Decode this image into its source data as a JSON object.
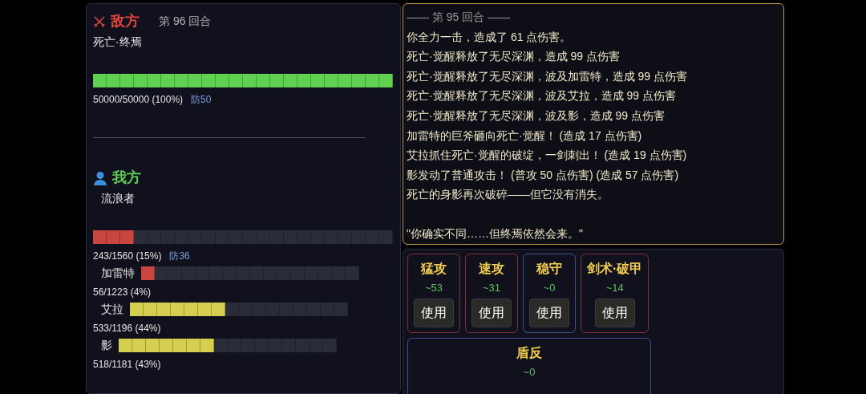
{
  "enemy": {
    "label": "敌方",
    "round": "第 96 回合",
    "name": "死亡·终焉",
    "hp": {
      "level": 1,
      "color": "#5fd04f"
    },
    "stats": "50000/50000 (100%)",
    "defense": "防50"
  },
  "player": {
    "label": "我方",
    "name": "流浪者",
    "hp": {
      "level": 0.136,
      "color": "#c8463f"
    },
    "stats": "243/1560 (15%)",
    "defense": "防36"
  },
  "allies": [
    {
      "name": "加雷特",
      "level": 0.0625,
      "color": "#c8463f",
      "stats": "56/1223 (4%)"
    },
    {
      "name": "艾拉",
      "level": 0.4375,
      "color": "#d4cf4e",
      "stats": "533/1196 (44%)"
    },
    {
      "name": "影",
      "level": 0.4375,
      "color": "#d4cf4e",
      "stats": "518/1181 (43%)"
    }
  ],
  "log": {
    "header": "—— 第 95 回合 ——",
    "lines": [
      "你全力一击，造成了 61 点伤害。",
      "死亡·觉醒释放了无尽深渊，造成 99 点伤害",
      "死亡·觉醒释放了无尽深渊，波及加雷特，造成 99 点伤害",
      "死亡·觉醒释放了无尽深渊，波及艾拉，造成 99 点伤害",
      "死亡·觉醒释放了无尽深渊，波及影，造成 99 点伤害",
      "加雷特的巨斧砸向死亡·觉醒！ (造成 17 点伤害)",
      "艾拉抓住死亡·觉醒的破绽，一剑刺出！ (造成 19 点伤害)",
      "影发动了普通攻击！ (普攻 50 点伤害) (造成 57 点伤害)",
      "死亡的身影再次破碎——但它没有消失。"
    ],
    "quote": "\"你确实不同……但终焉依然会来。\""
  },
  "skills": [
    {
      "kind": "attack",
      "name": "猛攻",
      "estimate": "~53",
      "button": "使用"
    },
    {
      "kind": "attack",
      "name": "速攻",
      "estimate": "~31",
      "button": "使用"
    },
    {
      "kind": "defense",
      "name": "稳守",
      "estimate": "~0",
      "button": "使用"
    },
    {
      "kind": "attack",
      "name": "剑术·破甲",
      "estimate": "~14",
      "button": "使用"
    },
    {
      "kind": "defense",
      "name": "盾反",
      "estimate": "~0"
    }
  ]
}
